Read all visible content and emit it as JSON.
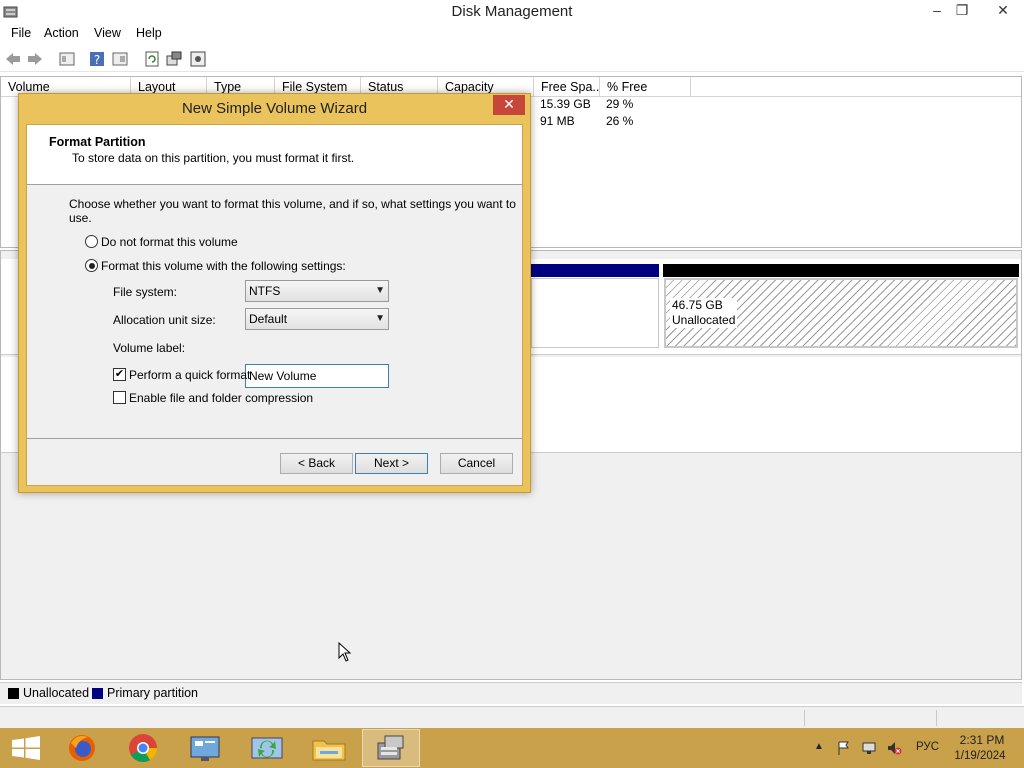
{
  "window": {
    "title": "Disk Management",
    "controls": {
      "minimize": "–",
      "restore": "❐",
      "close": "✕"
    }
  },
  "menu": [
    "File",
    "Action",
    "View",
    "Help"
  ],
  "toolbar_icons": [
    "back-arrow-icon",
    "forward-arrow-icon",
    "properties-icon",
    "help-icon",
    "view-icon",
    "refresh-icon",
    "rescan-disks-icon",
    "settings-icon"
  ],
  "volume_list": {
    "columns": [
      "Volume",
      "Layout",
      "Type",
      "File System",
      "Status",
      "Capacity",
      "Free Spa...",
      "% Free"
    ],
    "rows": [
      {
        "free_space": "15.39 GB",
        "percent_free": "29 %"
      },
      {
        "free_space": "91 MB",
        "percent_free": "26 %"
      }
    ]
  },
  "graphical_view": {
    "unallocated_size": "46.75 GB",
    "unallocated_label": "Unallocated"
  },
  "legend": [
    {
      "label": "Unallocated",
      "color": "#000000"
    },
    {
      "label": "Primary partition",
      "color": "#000080"
    }
  ],
  "dialog": {
    "title": "New Simple Volume Wizard",
    "close": "✕",
    "header_title": "Format Partition",
    "header_subtitle": "To store data on this partition, you must format it first.",
    "instruction": "Choose whether you want to format this volume, and if so, what settings you want to use.",
    "option_no_format": "Do not format this volume",
    "option_format": "Format this volume with the following settings:",
    "file_system_label": "File system:",
    "file_system_value": "NTFS",
    "allocation_label": "Allocation unit size:",
    "allocation_value": "Default",
    "volume_label_label": "Volume label:",
    "volume_label_value": "New Volume",
    "quick_format_label": "Perform a quick format",
    "compression_label": "Enable file and folder compression",
    "quick_format_checked": true,
    "compression_checked": false,
    "format_selected": true,
    "back_button": "< Back",
    "next_button": "Next >",
    "cancel_button": "Cancel"
  },
  "taskbar": {
    "apps": [
      "start-icon",
      "firefox-icon",
      "chrome-icon",
      "control-panel-icon",
      "sync-icon",
      "file-explorer-icon",
      "disk-management-icon"
    ],
    "language": "РУС",
    "time": "2:31 PM",
    "date": "1/19/2024"
  },
  "colors": {
    "accent": "#ebc35c",
    "taskbar": "#c9a14b",
    "primary_partition": "#000080",
    "unallocated": "#000000",
    "dialog_close": "#c7463a"
  }
}
